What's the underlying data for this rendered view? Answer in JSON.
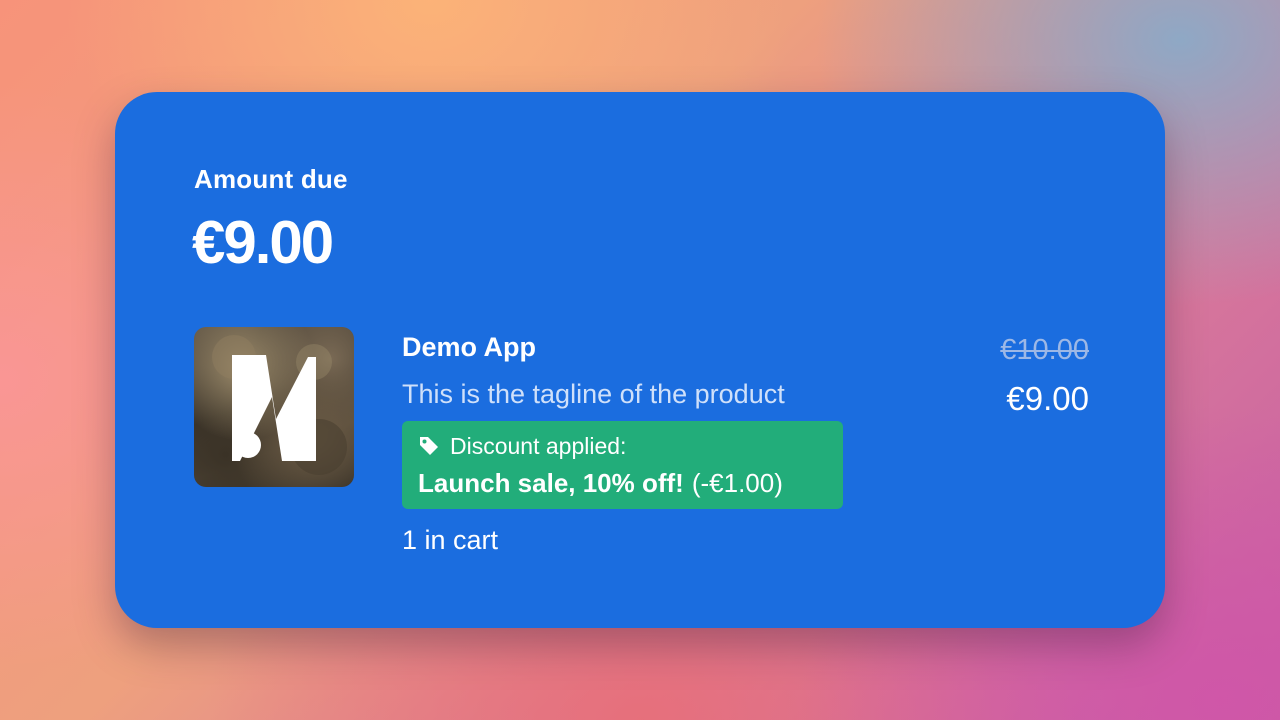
{
  "checkout": {
    "amount_label": "Amount due",
    "amount_value": "€9.00"
  },
  "product": {
    "image_icon": "product-logo-image",
    "name": "Demo App",
    "tagline": "This is the tagline of the product",
    "discount": {
      "icon": "tag-icon",
      "label": "Discount applied:",
      "name": "Launch sale, 10% off!",
      "amount": "(-€1.00)"
    },
    "quantity_text": "1 in cart",
    "original_price": "€10.00",
    "final_price": "€9.00"
  },
  "colors": {
    "card_background": "#1b6ddf",
    "discount_background": "#22ad7a",
    "strike_price": "#9db8e6"
  }
}
